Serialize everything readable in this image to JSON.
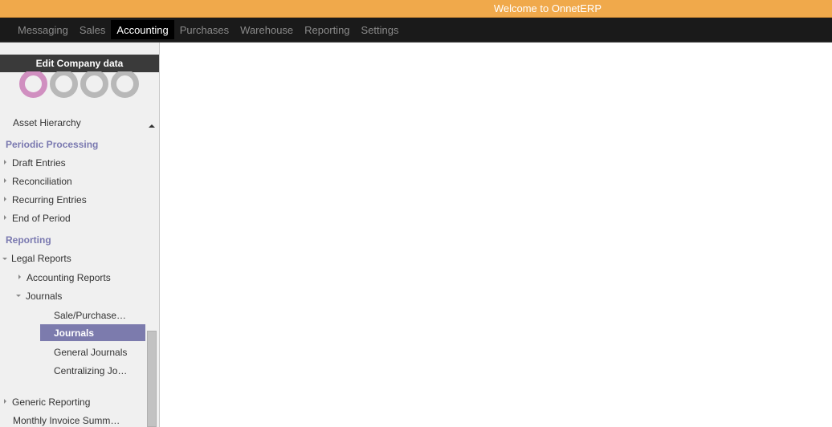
{
  "welcome_text": "Welcome to OnnetERP",
  "nav": {
    "items": [
      "Messaging",
      "Sales",
      "Accounting",
      "Purchases",
      "Warehouse",
      "Reporting",
      "Settings"
    ],
    "active": "Accounting"
  },
  "sidebar": {
    "company_header": "Edit Company data",
    "items": {
      "asset_hierarchy": "Asset Hierarchy",
      "periodic_processing": "Periodic Processing",
      "draft_entries": "Draft Entries",
      "reconciliation": "Reconciliation",
      "recurring_entries": "Recurring Entries",
      "end_of_period": "End of Period",
      "reporting": "Reporting",
      "legal_reports": "Legal Reports",
      "accounting_reports": "Accounting Reports",
      "journals_group": "Journals",
      "sale_purchase": "Sale/Purchase…",
      "journals_selected": "Journals",
      "general_journals": "General Journals",
      "centralizing": "Centralizing Jo…",
      "generic_reporting": "Generic Reporting",
      "monthly_invoice": "Monthly Invoice Summ…"
    }
  },
  "colors": {
    "welcome_bar": "#f0a94b",
    "nav_bg": "#1a1a1a",
    "section_title": "#7a79b0",
    "selected_bg": "#7c7bad",
    "logo_pink": "#d08fc0",
    "logo_grey": "#b8b8b8"
  }
}
